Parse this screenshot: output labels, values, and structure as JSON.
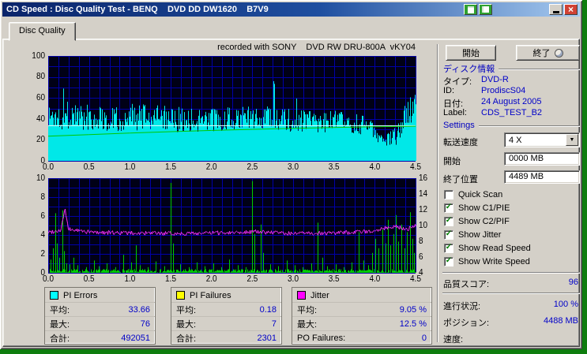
{
  "window": {
    "title": "CD Speed : Disc Quality Test - BENQ    DVD DD DW1620    B7V9"
  },
  "tab": {
    "label": "Disc Quality"
  },
  "charts": {
    "header": "recorded with SONY    DVD RW DRU-800A  vKY04"
  },
  "sidebar": {
    "start_button": "開始",
    "exit_button": "終了",
    "disc_info": {
      "header": "ディスク情報",
      "rows": [
        {
          "label": "タイプ:",
          "value": "DVD-R"
        },
        {
          "label": "ID:",
          "value": "ProdiscS04"
        },
        {
          "label": "日付:",
          "value": "24 August 2005"
        },
        {
          "label": "Label:",
          "value": "CDS_TEST_B2"
        }
      ]
    },
    "settings": {
      "header": "Settings",
      "speed_label": "転送速度",
      "speed_value": "4 X",
      "start_label": "開始",
      "start_value": "0000 MB",
      "end_label": "終了位置",
      "end_value": "4489 MB",
      "checkboxes": [
        {
          "label": "Quick Scan",
          "checked": false,
          "mark": ""
        },
        {
          "label": "Show C1/PIE",
          "checked": true,
          "mark": "✓"
        },
        {
          "label": "Show C2/PIF",
          "checked": true,
          "mark": "✓"
        },
        {
          "label": "Show Jitter",
          "checked": true,
          "mark": "✓"
        },
        {
          "label": "Show Read Speed",
          "checked": true,
          "mark": "✓"
        },
        {
          "label": "Show Write Speed",
          "checked": true,
          "mark": "✓"
        }
      ]
    },
    "score": {
      "label": "品質スコア:",
      "value": "96"
    },
    "status": [
      {
        "label": "進行状況:",
        "value": "100 %"
      },
      {
        "label": "ポジション:",
        "value": "4488 MB"
      },
      {
        "label": "速度:",
        "value": ""
      }
    ]
  },
  "stats_panels": [
    {
      "title": "PI Errors",
      "swatch": "#00FFFF",
      "swatch_style": "background:#00FFFF",
      "rows": [
        {
          "label": "平均:",
          "value": "33.66"
        },
        {
          "label": "最大:",
          "value": "76"
        },
        {
          "label": "合計:",
          "value": "492051"
        }
      ]
    },
    {
      "title": "PI Failures",
      "swatch": "#FFFF00",
      "swatch_style": "background:#FFFF00",
      "rows": [
        {
          "label": "平均:",
          "value": "0.18"
        },
        {
          "label": "最大:",
          "value": "7"
        },
        {
          "label": "合計:",
          "value": "2301"
        }
      ]
    },
    {
      "title": "Jitter",
      "swatch": "#FF00FF",
      "swatch_style": "background:#FF00FF",
      "rows": [
        {
          "label": "平均:",
          "value": "9.05 %"
        },
        {
          "label": "最大:",
          "value": "12.5 %"
        },
        {
          "label": "PO Failures:",
          "value": "0"
        }
      ]
    }
  ],
  "chart_data": [
    {
      "type": "area",
      "title": "PI Errors / Write Speed",
      "xlabel": "",
      "ylabel": "",
      "x_range": [
        0,
        4.5
      ],
      "x_ticks": [
        "0.0",
        "0.5",
        "1.0",
        "1.5",
        "2.0",
        "2.5",
        "3.0",
        "3.5",
        "4.0",
        "4.5"
      ],
      "ylim": [
        0,
        100
      ],
      "y_ticks": [
        100,
        80,
        60,
        40,
        20,
        0
      ],
      "grid": {
        "x_step": 0.125,
        "y_step": 10,
        "color": "#0000A8",
        "bg": "#000016"
      },
      "series": [
        {
          "name": "PI Errors",
          "color": "#00E8E8",
          "render": "noise-area",
          "seed": 1337,
          "spike_prob": 0.012,
          "spike_cap": 76,
          "spike_extra": 26,
          "envelope": [
            [
              0,
              28,
              56
            ],
            [
              0.3,
              30,
              58
            ],
            [
              0.6,
              28,
              54
            ],
            [
              1.0,
              28,
              55
            ],
            [
              1.5,
              27,
              52
            ],
            [
              2.0,
              28,
              50
            ],
            [
              2.5,
              30,
              54
            ],
            [
              3.0,
              27,
              50
            ],
            [
              3.5,
              27,
              48
            ],
            [
              3.9,
              24,
              44
            ],
            [
              4.0,
              19,
              34
            ],
            [
              4.1,
              13,
              27
            ],
            [
              4.2,
              12,
              29
            ],
            [
              4.3,
              17,
              40
            ],
            [
              4.4,
              28,
              60
            ],
            [
              4.45,
              36,
              64
            ],
            [
              4.5,
              40,
              66
            ]
          ]
        },
        {
          "name": "PIE average line",
          "color": "#D8FFFF",
          "render": "hline",
          "y": 34
        },
        {
          "name": "Write Speed",
          "color": "#00C800",
          "render": "line",
          "points": [
            [
              0,
              23.5
            ],
            [
              0.5,
              25.0
            ],
            [
              1.0,
              26.5
            ],
            [
              1.5,
              27.8
            ],
            [
              2.0,
              29.0
            ],
            [
              2.5,
              30.0
            ],
            [
              3.0,
              31.0
            ],
            [
              3.5,
              31.8
            ],
            [
              4.0,
              32.5
            ],
            [
              4.5,
              33.0
            ]
          ]
        }
      ],
      "stats": {
        "average": 33.66,
        "maximum": 76,
        "total": 492051
      }
    },
    {
      "type": "line",
      "title": "PI Failures / Jitter",
      "xlabel": "",
      "ylabel": "",
      "x_range": [
        0,
        4.5
      ],
      "x_ticks": [
        "0.0",
        "0.5",
        "1.0",
        "1.5",
        "2.0",
        "2.5",
        "3.0",
        "3.5",
        "4.0",
        "4.5"
      ],
      "ylim": [
        0,
        10
      ],
      "y_ticks": [
        10,
        8,
        6,
        4,
        2,
        0
      ],
      "y2lim": [
        4,
        16
      ],
      "y2_ticks": [
        16,
        14,
        12,
        10,
        8,
        6,
        4
      ],
      "grid": {
        "x_step": 0.125,
        "y_step": 1,
        "color": "#0000A8",
        "bg": "#000016"
      },
      "series": [
        {
          "name": "PI Failures",
          "color": "#00CC00",
          "render": "spikes",
          "seed": 7,
          "base_noise": 0.4,
          "spikes": [
            [
              0.03,
              1.4
            ],
            [
              0.06,
              2.6
            ],
            [
              0.09,
              6.3
            ],
            [
              0.11,
              3.1
            ],
            [
              0.14,
              1.6
            ],
            [
              0.17,
              6.6
            ],
            [
              0.19,
              2.3
            ],
            [
              0.22,
              1.0
            ],
            [
              0.26,
              0.9
            ],
            [
              0.31,
              1.6
            ],
            [
              0.36,
              0.8
            ],
            [
              0.46,
              0.6
            ],
            [
              0.56,
              1.3
            ],
            [
              0.62,
              0.7
            ],
            [
              0.72,
              1.0
            ],
            [
              0.82,
              0.6
            ],
            [
              0.92,
              1.9
            ],
            [
              1.02,
              1.1
            ],
            [
              1.07,
              2.9
            ],
            [
              1.12,
              0.8
            ],
            [
              1.22,
              0.6
            ],
            [
              1.32,
              1.2
            ],
            [
              1.42,
              0.7
            ],
            [
              1.5,
              9.5
            ],
            [
              1.53,
              3.1
            ],
            [
              1.62,
              0.9
            ],
            [
              1.72,
              0.6
            ],
            [
              1.82,
              1.1
            ],
            [
              1.92,
              0.7
            ],
            [
              2.02,
              1.0
            ],
            [
              2.12,
              0.6
            ],
            [
              2.22,
              1.4
            ],
            [
              2.32,
              0.8
            ],
            [
              2.42,
              0.6
            ],
            [
              2.5,
              9.7
            ],
            [
              2.53,
              4.1
            ],
            [
              2.6,
              5.1
            ],
            [
              2.63,
              2.1
            ],
            [
              2.72,
              0.9
            ],
            [
              2.82,
              0.7
            ],
            [
              2.92,
              1.3
            ],
            [
              3.02,
              0.8
            ],
            [
              3.12,
              0.6
            ],
            [
              3.22,
              1.0
            ],
            [
              3.3,
              5.3
            ],
            [
              3.36,
              1.6
            ],
            [
              3.42,
              0.7
            ],
            [
              3.52,
              0.9
            ],
            [
              3.62,
              0.6
            ],
            [
              3.72,
              1.1
            ],
            [
              3.8,
              4.3
            ],
            [
              3.86,
              1.3
            ],
            [
              3.92,
              0.8
            ],
            [
              3.97,
              2.1
            ],
            [
              4.01,
              3.6
            ],
            [
              4.05,
              2.6
            ],
            [
              4.09,
              4.6
            ],
            [
              4.13,
              3.1
            ],
            [
              4.16,
              5.6
            ],
            [
              4.19,
              2.9
            ],
            [
              4.23,
              4.1
            ],
            [
              4.26,
              6.1
            ],
            [
              4.29,
              3.3
            ],
            [
              4.33,
              5.1
            ],
            [
              4.36,
              2.6
            ],
            [
              4.39,
              4.3
            ],
            [
              4.43,
              6.4
            ],
            [
              4.46,
              3.6
            ],
            [
              4.48,
              2.1
            ]
          ]
        },
        {
          "name": "Jitter",
          "color": "#FF30FF",
          "render": "noise-line",
          "seed": 99,
          "noise": 0.22,
          "envelope": [
            [
              0,
              4.3
            ],
            [
              0.15,
              4.5
            ],
            [
              0.2,
              6.8
            ],
            [
              0.24,
              4.6
            ],
            [
              0.5,
              4.3
            ],
            [
              1.0,
              4.2
            ],
            [
              1.5,
              4.15
            ],
            [
              2.0,
              4.2
            ],
            [
              2.5,
              4.35
            ],
            [
              3.0,
              4.15
            ],
            [
              3.5,
              4.2
            ],
            [
              3.9,
              4.35
            ],
            [
              4.1,
              4.7
            ],
            [
              4.25,
              4.9
            ],
            [
              4.4,
              4.6
            ],
            [
              4.5,
              5.1
            ]
          ]
        }
      ],
      "stats": {
        "pi_failures_average": 0.18,
        "pi_failures_maximum": 7,
        "pi_failures_total": 2301,
        "jitter_average_percent": 9.05,
        "jitter_maximum_percent": 12.5,
        "po_failures": 0
      }
    }
  ]
}
